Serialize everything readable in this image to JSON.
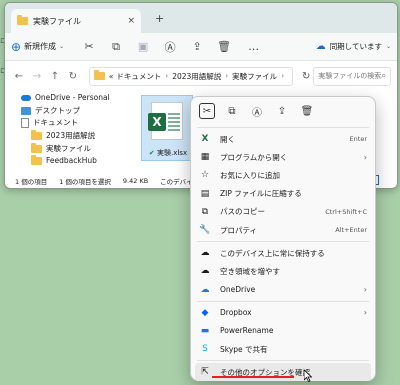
{
  "desktop": {
    "edge_fragment_1": "ロ",
    "edge_fragment_2": "ロ"
  },
  "window": {
    "tab_title": "実験ファイル",
    "tab_close": "×",
    "new_tab": "+",
    "toolbar": {
      "new_label": "新規作成",
      "more_label": "…",
      "sync_status": "同期しています"
    },
    "address": {
      "path_prefix": "«",
      "segments": [
        "ドキュメント",
        "2023用語解説",
        "実験ファイル"
      ],
      "search_placeholder": "実験ファイルの検索"
    },
    "nav_tree": [
      {
        "label": "OneDrive - Personal",
        "icon": "onedrive-icon"
      },
      {
        "label": "デスクトップ",
        "icon": "desktop-icon"
      },
      {
        "label": "ドキュメント",
        "icon": "document-icon"
      },
      {
        "label": "2023用語解説",
        "icon": "folder-icon"
      },
      {
        "label": "実験ファイル",
        "icon": "folder-icon"
      },
      {
        "label": "FeedbackHub",
        "icon": "folder-icon"
      }
    ],
    "file": {
      "name": "実験.xlsx",
      "icon": "excel-icon"
    },
    "status_bar": {
      "item_count": "1 個の項目",
      "selected": "1 個の項目を選択",
      "size": "9.42 KB",
      "availability": "このデバイスで使用"
    }
  },
  "context_menu": {
    "items": [
      {
        "label": "開く",
        "shortcut": "Enter",
        "icon": "excel-icon"
      },
      {
        "label": "プログラムから開く",
        "submenu": true,
        "icon": "open-with-icon"
      },
      {
        "label": "お気に入りに追加",
        "icon": "star-icon"
      },
      {
        "label": "ZIP ファイルに圧縮する",
        "icon": "zip-icon"
      },
      {
        "label": "パスのコピー",
        "shortcut": "Ctrl+Shift+C",
        "icon": "copy-path-icon"
      },
      {
        "label": "プロパティ",
        "shortcut": "Alt+Enter",
        "icon": "wrench-icon"
      },
      {
        "label": "このデバイス上に常に保持する",
        "icon": "cloud-keep-icon"
      },
      {
        "label": "空き領域を増やす",
        "icon": "free-space-icon"
      },
      {
        "label": "OneDrive",
        "submenu": true,
        "icon": "onedrive-icon"
      },
      {
        "label": "Dropbox",
        "submenu": true,
        "icon": "dropbox-icon"
      },
      {
        "label": "PowerRename",
        "icon": "powerrename-icon"
      },
      {
        "label": "Skype で共有",
        "icon": "skype-icon"
      },
      {
        "label": "その他のオプションを確認",
        "icon": "more-options-icon"
      }
    ],
    "arrow_glyph": "›"
  },
  "colors": {
    "desktop_bg": "#a9cfa9",
    "accent": "#1a6fc4",
    "excel_green": "#1d6f42",
    "underline_red": "#e2202c"
  }
}
